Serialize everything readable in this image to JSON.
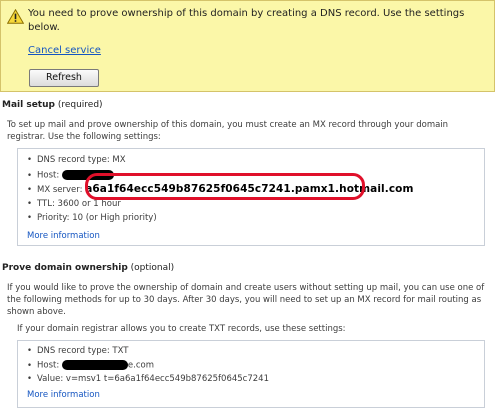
{
  "warning": {
    "icon": "warning-triangle-icon",
    "message": "You need to prove ownership of this domain by creating a DNS record. Use the settings below.",
    "cancel_link": "Cancel service",
    "refresh_label": "Refresh"
  },
  "mail_setup": {
    "heading": "Mail setup",
    "heading_suffix": " (required)",
    "intro": "To set up mail and prove ownership of this domain, you must create an MX record through your domain registrar. Use the following settings:",
    "items": {
      "type": "DNS record type: MX",
      "host_label": "Host: ",
      "mx_label": "MX server: ",
      "mx_value": "a6a1f64ecc549b87625f0645c7241.pamx1.hotmail.com",
      "ttl": "TTL: 3600 or 1 hour",
      "priority": "Priority: 10 (or High priority)"
    },
    "more_info": "More information"
  },
  "prove": {
    "heading": "Prove domain ownership",
    "heading_suffix": " (optional)",
    "intro": "If you would like to prove the ownership of domain and create users without setting up mail, you can use one of the following methods for up to 30 days. After 30 days, you will need to set up an MX record for mail routing as shown above.",
    "txt_note": "If your domain registrar allows you to create TXT records, use these settings:",
    "items": {
      "type": "DNS record type: TXT",
      "host_label": "Host: ",
      "host_suffix": "e.com",
      "value": "Value: v=msv1 t=6a6a1f64ecc549b87625f0645c7241"
    },
    "more_info": "More information"
  },
  "colors": {
    "warning_bg": "#fbf7a8",
    "link": "#1455c1",
    "annotation": "#e0102a"
  }
}
